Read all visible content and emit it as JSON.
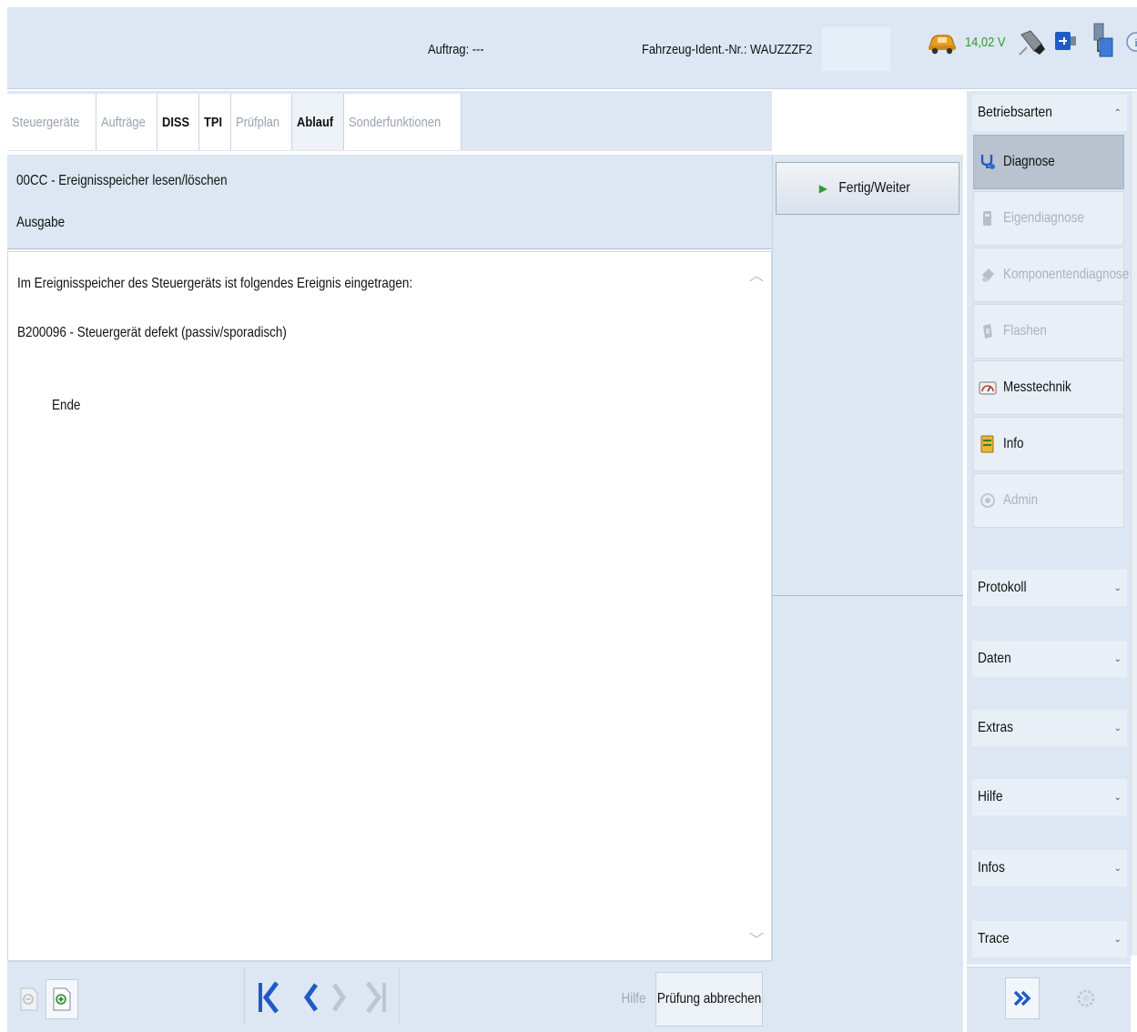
{
  "header": {
    "auftrag": "Auftrag: ---",
    "fahrzeug_ident": "Fahrzeug-Ident.-Nr.: WAUZZZF2",
    "voltage": "14,02 V"
  },
  "tabs": [
    {
      "label": "Steuergeräte",
      "style": "disabled"
    },
    {
      "label": "Aufträge",
      "style": "disabled"
    },
    {
      "label": "DISS",
      "style": "bold"
    },
    {
      "label": "TPI",
      "style": "bold"
    },
    {
      "label": "Prüfplan",
      "style": "disabled"
    },
    {
      "label": "Ablauf",
      "style": "active"
    },
    {
      "label": "Sonderfunktionen",
      "style": "disabled"
    }
  ],
  "title": {
    "line1": "00CC - Ereignisspeicher lesen/löschen",
    "line2": "Ausgabe"
  },
  "content": {
    "line1": "Im Ereignisspeicher des Steuergeräts ist folgendes Ereignis eingetragen:",
    "line2": "B200096 - Steuergerät defekt (passiv/sporadisch)",
    "line3": "Ende"
  },
  "actions": {
    "fertig_weiter": "Fertig/Weiter",
    "hilfe": "Hilfe",
    "pruefung_abbrechen": "Prüfung abbrechen"
  },
  "sidebar": {
    "betriebsarten": "Betriebsarten",
    "modes": [
      {
        "label": "Diagnose",
        "state": "selected",
        "icon": "stethoscope-icon"
      },
      {
        "label": "Eigendiagnose",
        "state": "disabled",
        "icon": "tool-icon"
      },
      {
        "label": "Komponentendiagnose",
        "state": "disabled",
        "icon": "component-icon"
      },
      {
        "label": "Flashen",
        "state": "disabled",
        "icon": "flash-icon"
      },
      {
        "label": "Messtechnik",
        "state": "normal",
        "icon": "gauge-icon"
      },
      {
        "label": "Info",
        "state": "normal",
        "icon": "info-book-icon"
      },
      {
        "label": "Admin",
        "state": "disabled",
        "icon": "admin-icon"
      }
    ],
    "sections": [
      "Protokoll",
      "Daten",
      "Extras",
      "Hilfe",
      "Infos",
      "Trace"
    ]
  },
  "colors": {
    "panel": "#dde7f3",
    "accent_blue": "#1f5bc6",
    "voltage_green": "#2f9a2f"
  }
}
